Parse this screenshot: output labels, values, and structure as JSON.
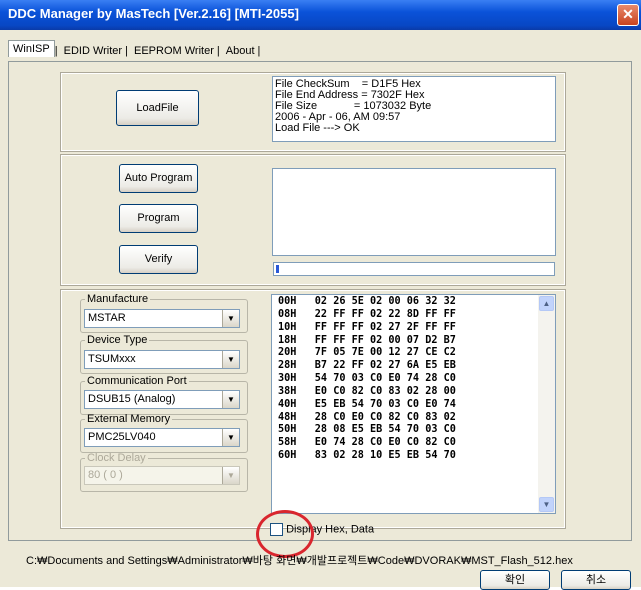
{
  "window": {
    "title": "DDC Manager  by MasTech  [Ver.2.16]  [MTI-2055]",
    "close_symbol": "✕"
  },
  "tabs": [
    {
      "label": "WinISP"
    },
    {
      "label": "EDID Writer"
    },
    {
      "label": "EEPROM Writer"
    },
    {
      "label": "About"
    }
  ],
  "load": {
    "button_label": "LoadFile",
    "info": "File CheckSum    = D1F5 Hex\nFile End Address = 7302F Hex\nFile Size            = 1073032 Byte\n2006 - Apr - 06, AM 09:57\nLoad File ---> OK"
  },
  "actions": {
    "auto_program_label": "Auto Program",
    "program_label": "Program",
    "verify_label": "Verify",
    "progress_fraction": 0.01
  },
  "settings": {
    "manufacture": {
      "label": "Manufacture",
      "value": "MSTAR"
    },
    "device_type": {
      "label": "Device Type",
      "value": "TSUMxxx"
    },
    "comm_port": {
      "label": "Communication Port",
      "value": "DSUB15 (Analog)"
    },
    "external_memory": {
      "label": "External Memory",
      "value": "PMC25LV040"
    },
    "clock_delay": {
      "label": "Clock Delay",
      "value": "80 ( 0 )"
    }
  },
  "hex": {
    "rows": [
      "00H   02 26 5E 02 00 06 32 32",
      "08H   22 FF FF 02 22 8D FF FF",
      "10H   FF FF FF 02 27 2F FF FF",
      "18H   FF FF FF 02 00 07 D2 B7",
      "20H   7F 05 7E 00 12 27 CE C2",
      "28H   B7 22 FF 02 27 6A E5 EB",
      "30H   54 70 03 C0 E0 74 28 C0",
      "38H   E0 C0 82 C0 83 02 28 00",
      "40H   E5 EB 54 70 03 C0 E0 74",
      "48H   28 C0 E0 C0 82 C0 83 02",
      "50H   28 08 E5 EB 54 70 03 C0",
      "58H   E0 74 28 C0 E0 C0 82 C0",
      "60H   83 02 28 10 E5 EB 54 70"
    ],
    "display_checkbox_label": "Display Hex, Data"
  },
  "status": {
    "path": "C:₩Documents and Settings₩Administrator₩바탕 화면₩개발프로젝트₩Code₩DVORAK₩MST_Flash_512.hex"
  },
  "footer": {
    "ok_label": "확인",
    "cancel_label": "취소"
  }
}
